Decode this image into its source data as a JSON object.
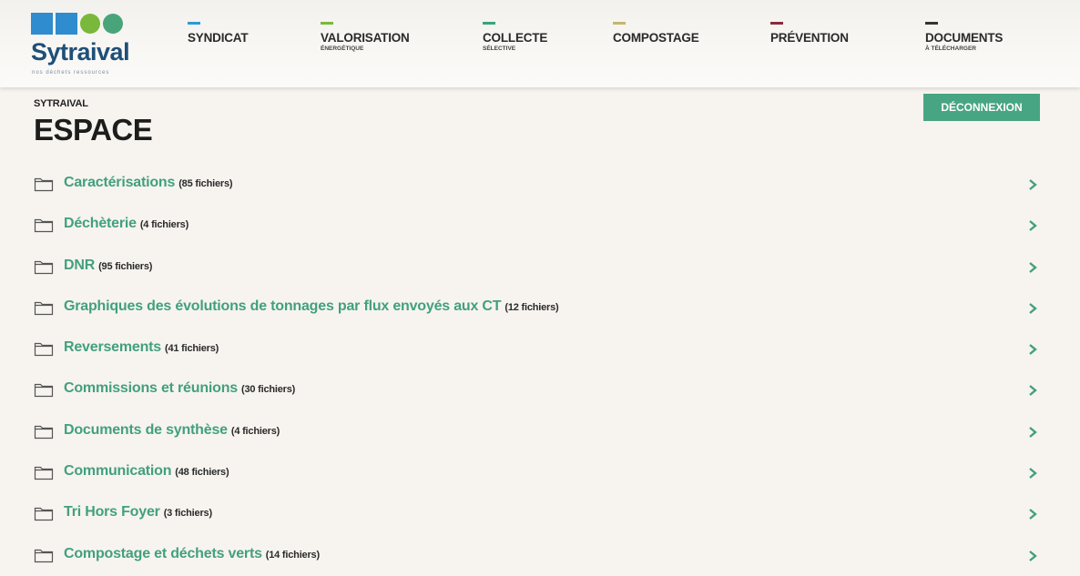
{
  "colors": {
    "accent": "#48a583",
    "link": "#42a07e",
    "logo_text": "#1f4f78",
    "logo_shapes": [
      "#2e8ccf",
      "#2e8ccf",
      "#7ab83b",
      "#4aa47a"
    ]
  },
  "logo": {
    "name": "Sytraival",
    "tagline": "nos déchets ressources"
  },
  "nav": [
    {
      "label": "SYNDICAT",
      "sub": "",
      "bar_color": "#2e9ad6"
    },
    {
      "label": "VALORISATION",
      "sub": "ÉNERGÉTIQUE",
      "bar_color": "#7ab83b"
    },
    {
      "label": "COLLECTE",
      "sub": "SÉLECTIVE",
      "bar_color": "#3aa37a"
    },
    {
      "label": "COMPOSTAGE",
      "sub": "",
      "bar_color": "#c7b56a"
    },
    {
      "label": "PRÉVENTION",
      "sub": "",
      "bar_color": "#8b2a3a"
    },
    {
      "label": "DOCUMENTS",
      "sub": "À TÉLÉCHARGER",
      "bar_color": "#333333"
    }
  ],
  "breadcrumb": "SYTRAIVAL",
  "page_title": "ESPACE",
  "logout_label": "DÉCONNEXION",
  "folders": [
    {
      "name": "Caractérisations",
      "count": "(85 fichiers)"
    },
    {
      "name": "Déchèterie",
      "count": "(4 fichiers)"
    },
    {
      "name": "DNR",
      "count": "(95 fichiers)"
    },
    {
      "name": "Graphiques des évolutions de tonnages par flux envoyés aux CT",
      "count": "(12 fichiers)"
    },
    {
      "name": "Reversements",
      "count": "(41 fichiers)"
    },
    {
      "name": "Commissions et réunions",
      "count": "(30 fichiers)"
    },
    {
      "name": "Documents de synthèse",
      "count": "(4 fichiers)"
    },
    {
      "name": "Communication",
      "count": "(48 fichiers)"
    },
    {
      "name": "Tri Hors Foyer",
      "count": "(3 fichiers)"
    },
    {
      "name": "Compostage et déchets verts",
      "count": "(14 fichiers)"
    }
  ],
  "icons": {
    "folder": "folder-icon",
    "chevron": "chevron-right-icon"
  }
}
